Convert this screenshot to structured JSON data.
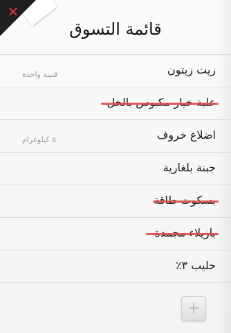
{
  "header": {
    "title": "قائمة التسوق",
    "close_label": "✕"
  },
  "items": [
    {
      "name": "زيت زيتون",
      "quantity": "قنينة واحدة",
      "checked": false
    },
    {
      "name": "علبة خيار مكبوس بالخل",
      "quantity": "",
      "checked": true
    },
    {
      "name": "اضلاع خروف",
      "quantity": "٥ كيلوغرام",
      "checked": false
    },
    {
      "name": "جبنة بلغارية",
      "quantity": "",
      "checked": false
    },
    {
      "name": "بسكوت طاقة",
      "quantity": "",
      "checked": true
    },
    {
      "name": "بازيلاء مجمدة",
      "quantity": "",
      "checked": true
    },
    {
      "name": "حليب ٣٪",
      "quantity": "",
      "checked": false
    }
  ],
  "add_button": {
    "label": "+"
  },
  "colors": {
    "strike": "#e04a4a",
    "close": "#e03a3a"
  }
}
